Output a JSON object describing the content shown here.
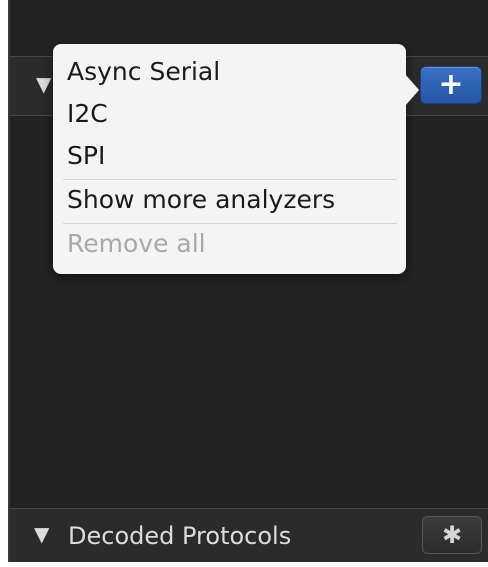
{
  "analyzers": {
    "caret_glyph": "▼",
    "add_glyph": "+"
  },
  "menu": {
    "items": [
      {
        "label": "Async Serial",
        "enabled": true
      },
      {
        "label": "I2C",
        "enabled": true
      },
      {
        "label": "SPI",
        "enabled": true
      },
      {
        "label": "Show more analyzers",
        "enabled": true
      },
      {
        "label": "Remove all",
        "enabled": false
      }
    ]
  },
  "footer": {
    "caret_glyph": "▼",
    "title": "Decoded Protocols",
    "gear_glyph": "✱"
  },
  "icons": {
    "add": "plus-icon",
    "settings": "gear-icon",
    "collapse": "triangle-down-icon"
  },
  "colors": {
    "panel_bg": "#232323",
    "add_button": "#2f64b5",
    "menu_bg": "#f4f4f4",
    "disabled_text": "#a8a8a8"
  }
}
